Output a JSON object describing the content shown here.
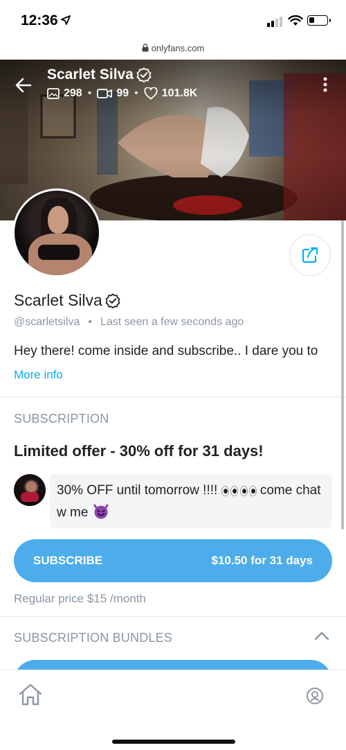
{
  "status_bar": {
    "time": "12:36"
  },
  "browser": {
    "url": "onlyfans.com"
  },
  "header": {
    "name": "Scarlet Silva",
    "stats": {
      "photos": "298",
      "videos": "99",
      "likes": "101.8K"
    }
  },
  "profile": {
    "name": "Scarlet Silva",
    "handle": "@scarletsilva",
    "separator": "•",
    "last_seen": "Last seen a few seconds ago",
    "bio": "Hey there! come inside and subscribe.. I dare you to",
    "more_info": "More info"
  },
  "subscription": {
    "section_label": "SUBSCRIPTION",
    "offer_title": "Limited offer - 30% off for 31 days!",
    "message_part1": "30% OFF until tomorrow !!!! ",
    "message_part2": " come chat w me ",
    "button_label": "SUBSCRIBE",
    "button_price": "$10.50 for 31 days",
    "regular_price": "Regular price $15 /month"
  },
  "bundles": {
    "section_label": "SUBSCRIPTION BUNDLES"
  },
  "colors": {
    "accent": "#00aff0",
    "button": "#4dadeb",
    "muted": "#8a96a3"
  },
  "icons": {
    "back": "arrow-left-icon",
    "verified": "verified-badge-icon",
    "more": "more-vertical-icon",
    "share": "share-icon",
    "home": "home-icon",
    "profile": "profile-icon"
  }
}
